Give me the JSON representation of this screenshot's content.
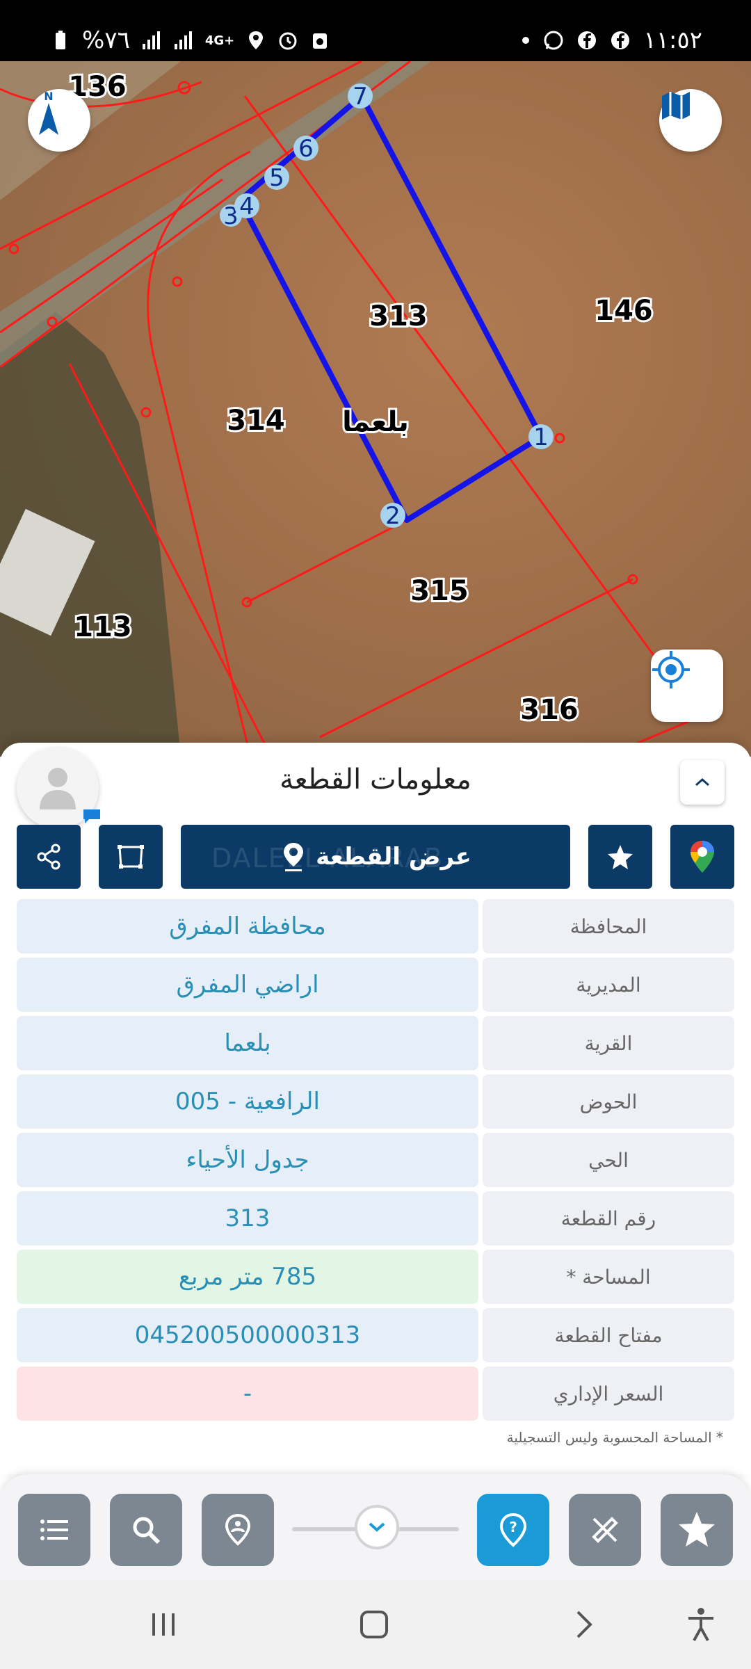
{
  "status_bar": {
    "battery": "%٧٦",
    "network": "4G+",
    "time": "١١:٥٢",
    "icons": [
      "battery-icon",
      "signal-icon",
      "signal-icon",
      "network-icon",
      "location-icon",
      "alarm-icon",
      "sync-icon",
      "dot-icon",
      "whatsapp-icon",
      "facebook-icon",
      "facebook-icon"
    ]
  },
  "map": {
    "parcels": {
      "p136": "136",
      "p146": "146",
      "p313": "313",
      "p314": "314",
      "p315": "315",
      "p113": "113",
      "p316": "316"
    },
    "village_label": "بلعما",
    "vertices": {
      "v1": "1",
      "v2": "2",
      "v3": "3",
      "v4": "4",
      "v5": "5",
      "v6": "6",
      "v7": "7"
    },
    "compass_label": "N",
    "colors": {
      "boundary": "#ff1a1a",
      "selected": "#1414e6"
    }
  },
  "sheet": {
    "title": "معلومات القطعة",
    "show_parcel_label": "عرض القطعة",
    "watermark": "DALEEL ALARAB",
    "rows": [
      {
        "label": "المحافظة",
        "value": "محافظة المفرق",
        "style": "default"
      },
      {
        "label": "المديرية",
        "value": "اراضي المفرق",
        "style": "default"
      },
      {
        "label": "القرية",
        "value": "بلعما",
        "style": "default"
      },
      {
        "label": "الحوض",
        "value": "الرافعية - 005",
        "style": "default"
      },
      {
        "label": "الحي",
        "value": "جدول الأحياء",
        "style": "default"
      },
      {
        "label": "رقم القطعة",
        "value": "313",
        "style": "default"
      },
      {
        "label": "المساحة *",
        "value": "785  متر مربع",
        "style": "green"
      },
      {
        "label": "مفتاح القطعة",
        "value": "045200500000313",
        "style": "default"
      },
      {
        "label": "السعر الإداري",
        "value": "-",
        "style": "pink"
      }
    ],
    "note": "* المساحة المحسوبة وليس التسجيلية"
  },
  "colors": {
    "primary": "#0b3a66",
    "accent": "#1a9ad6",
    "value_text": "#2a8fb5"
  }
}
